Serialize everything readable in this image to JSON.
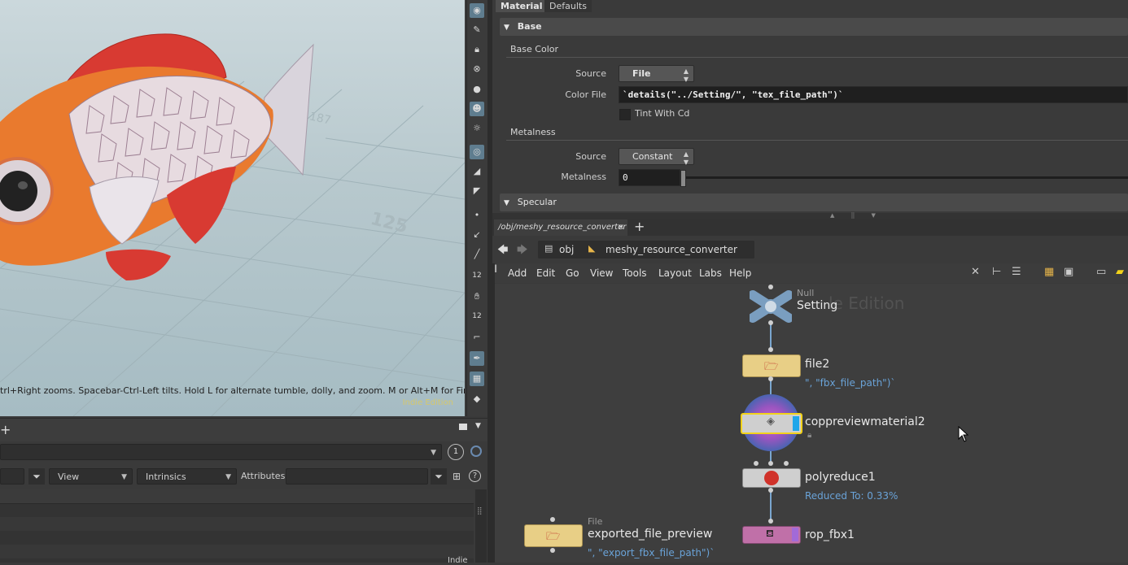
{
  "viewport": {
    "hint": "trl+Right zooms. Spacebar-Ctrl-Left tilts. Hold L for alternate tumble, dolly, and zoom. M or Alt+M for First Person",
    "badge": "Indie Edition",
    "grid_label_1": "125",
    "grid_label_2": "187"
  },
  "viewport_toolbar": {
    "icons": [
      "eye-icon",
      "pen-icon",
      "lock-icon",
      "tumble-icon",
      "sphere-icon",
      "skull-light-icon",
      "light-icon",
      "camera-icon",
      "brush-icon",
      "paint-icon",
      "dot-icon",
      "curve-icon",
      "pick-icon",
      "snap-12-icon",
      "hand-icon",
      "snap-12b-icon",
      "corner-icon",
      "pen-nib-icon",
      "checker-icon",
      "plane-icon"
    ],
    "label_12": "12",
    "label_12b": "12"
  },
  "lower_left": {
    "counter": "1",
    "view_label": "View",
    "intrinsics_label": "Intrinsics",
    "attributes_label": "Attributes:",
    "corner_label": "Indie"
  },
  "parameters": {
    "tabs": [
      "Material",
      "Defaults"
    ],
    "sections": {
      "base": "Base",
      "specular": "Specular"
    },
    "base_color_group": "Base Color",
    "source_label": "Source",
    "source_value": "File",
    "color_file_label": "Color File",
    "color_file_value": "`details(\"../Setting/\", \"tex_file_path\")`",
    "tint_label": "Tint With Cd",
    "metalness_group": "Metalness",
    "metal_source_label": "Source",
    "metal_source_value": "Constant",
    "metalness_label": "Metalness",
    "metalness_value": "0"
  },
  "network": {
    "tab_label": "/obj/meshy_resource_converter",
    "path_root": "obj",
    "path_node": "meshy_resource_converter",
    "menu": [
      "Add",
      "Edit",
      "Go",
      "View",
      "Tools",
      "Layout",
      "Labs",
      "Help"
    ],
    "watermark": "le Edition",
    "nodes": {
      "setting": {
        "type": "Null",
        "name": "Setting"
      },
      "file2": {
        "name": "file2",
        "info": "\", \"fbx_file_path\")`"
      },
      "copmat": {
        "name": "coppreviewmaterial2"
      },
      "polyreduce": {
        "name": "polyreduce1",
        "info": "Reduced To: 0.33%"
      },
      "rop": {
        "name": "rop_fbx1"
      },
      "export": {
        "type": "File",
        "name": "exported_file_preview",
        "info": "\", \"export_fbx_file_path\")`"
      }
    }
  },
  "colors": {
    "accent": "#5f7d8f",
    "info_text": "#6aa3d8",
    "file_node": "#e8cf86",
    "rop_node": "#c070a8",
    "selected": "#f2d21a"
  }
}
